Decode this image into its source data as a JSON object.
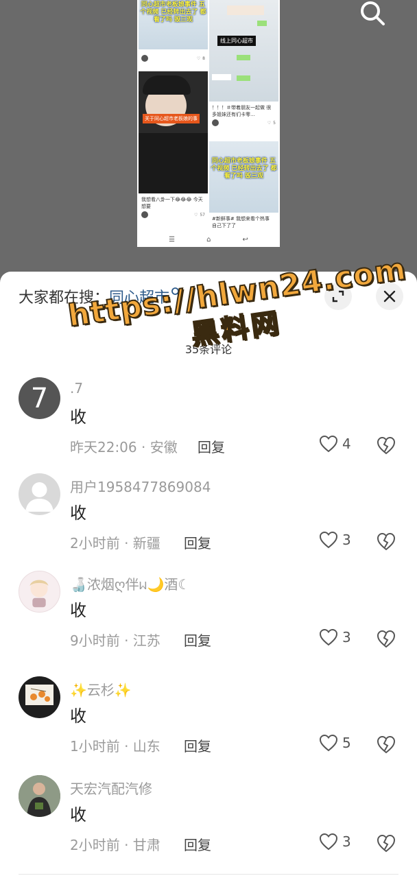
{
  "preview": {
    "card1_caption": "同心超市老板娘事件 五个视频 已经转出去了 都看了吗 毁三观",
    "card1_likes": "8",
    "card2_tag": "线上同心超市",
    "card3_tag": "关于同心超市老板娘的事",
    "card4_text": "！！！＃带着朋友一起做 很多姐妹还有们卡零…",
    "card4_likes": "5",
    "card5_caption": "同心超市老板娘事件 五个视频 已经转出去了 都看了吗 毁三观",
    "card6_text": "我想看八卦一下😂😂😂 今天想要",
    "card6_likes": "57",
    "card7_text": "#新鲜事# 我想来看个热事 自己下了了"
  },
  "sheet": {
    "header_prefix": "大家都在搜：",
    "header_term": "同心超市",
    "comment_count": "35条评论"
  },
  "watermark": {
    "line1": "https://hlwn24.com",
    "line2": "黑料网"
  },
  "comments": [
    {
      "avatar_text": "7",
      "name": ".7",
      "text": "收",
      "meta": "昨天22:06 · 安徽",
      "reply": "回复",
      "likes": "4"
    },
    {
      "name": "用户1958477869084",
      "text": "收",
      "meta": "2小时前 · 新疆",
      "reply": "回复",
      "likes": "3"
    },
    {
      "name": "🍶浓烟ღ伴ᥕ🌙酒☾",
      "text": "收",
      "meta": "9小时前 · 江苏",
      "reply": "回复",
      "likes": "3"
    },
    {
      "name": "✨云杉✨",
      "text": "收",
      "meta": "1小时前 · 山东",
      "reply": "回复",
      "likes": "5"
    },
    {
      "name": "天宏汽配汽修",
      "text": "收",
      "meta": "2小时前 · 甘肃",
      "reply": "回复",
      "likes": "3"
    }
  ],
  "icons": {
    "search": "search-icon",
    "expand": "expand-icon",
    "close": "close-icon",
    "like": "heart-icon",
    "dislike": "broken-heart-icon"
  }
}
